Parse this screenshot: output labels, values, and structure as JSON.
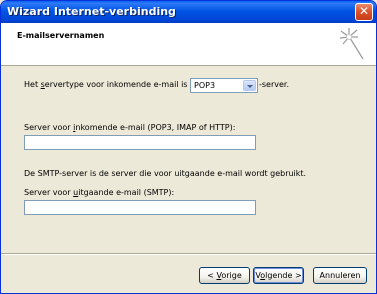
{
  "window": {
    "title": "Wizard Internet-verbinding",
    "close_glyph": "✕"
  },
  "header": {
    "title": "E-mailservernamen",
    "icon": "wizard-sparkle-icon"
  },
  "incoming_type": {
    "label_pre": "Het ",
    "label_accel": "s",
    "label_post": "ervertype voor inkomende e-mail is een:",
    "selected": "POP3",
    "suffix": "-server."
  },
  "incoming_server": {
    "label_pre": "Server voor ",
    "label_accel": "i",
    "label_post": "nkomende e-mail (POP3, IMAP of HTTP):",
    "value": ""
  },
  "smtp_info": "De SMTP-server is de server die voor uitgaande e-mail wordt gebruikt.",
  "outgoing_server": {
    "label_pre": "Server voor ",
    "label_accel": "u",
    "label_post": "itgaande e-mail (SMTP):",
    "value": ""
  },
  "buttons": {
    "back": {
      "pre": "< ",
      "accel": "V",
      "post": "orige"
    },
    "next": {
      "pre": "V",
      "accel": "o",
      "post": "lgende >"
    },
    "cancel": "Annuleren"
  }
}
